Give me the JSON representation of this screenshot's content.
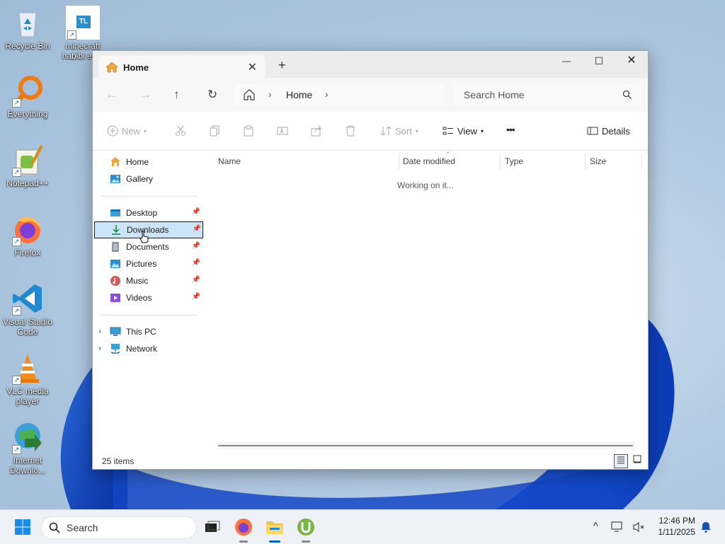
{
  "desktop": {
    "icons": [
      {
        "label": "Recycle Bin"
      },
      {
        "label": "minecraft habibi ed..."
      },
      {
        "label": "Everything"
      },
      {
        "label": "Notepad++"
      },
      {
        "label": "Firefox"
      },
      {
        "label": "Visual Studio Code"
      },
      {
        "label": "VLC media player"
      },
      {
        "label": "Internet Downlo..."
      }
    ],
    "minecraft_badge": "TL"
  },
  "window": {
    "tab_title": "Home",
    "close_tab": "✕",
    "new_tab": "+",
    "minimize": "—",
    "maximize": "☐",
    "close": "✕"
  },
  "nav": {
    "back": "←",
    "forward": "→",
    "up": "↑",
    "refresh": "↻",
    "breadcrumb": "Home",
    "sep": "›",
    "search_placeholder": "Search Home"
  },
  "commands": {
    "new": "New",
    "sort": "Sort",
    "view": "View",
    "more": "•••",
    "details": "Details"
  },
  "sidebar": {
    "items": [
      {
        "label": "Home",
        "icon": "home-icon"
      },
      {
        "label": "Gallery",
        "icon": "gallery-icon"
      },
      {
        "label": "Desktop",
        "icon": "desktop-icon",
        "pinned": true
      },
      {
        "label": "Downloads",
        "icon": "download-icon",
        "pinned": true,
        "selected": true
      },
      {
        "label": "Documents",
        "icon": "document-icon",
        "pinned": true
      },
      {
        "label": "Pictures",
        "icon": "pictures-icon",
        "pinned": true
      },
      {
        "label": "Music",
        "icon": "music-icon",
        "pinned": true
      },
      {
        "label": "Videos",
        "icon": "videos-icon",
        "pinned": true
      },
      {
        "label": "This PC",
        "icon": "pc-icon"
      },
      {
        "label": "Network",
        "icon": "network-icon"
      }
    ],
    "expand_glyph": "›"
  },
  "content": {
    "columns": [
      "Name",
      "Date modified",
      "Type",
      "Size"
    ],
    "status_text": "Working on it..."
  },
  "statusbar": {
    "count": "25 items"
  },
  "taskbar": {
    "search_label": "Search",
    "time": "12:46 PM",
    "date": "1/11/2025",
    "overflow": "^"
  },
  "colors": {
    "accent": "#0067c0",
    "selection": "#cce4f7"
  }
}
